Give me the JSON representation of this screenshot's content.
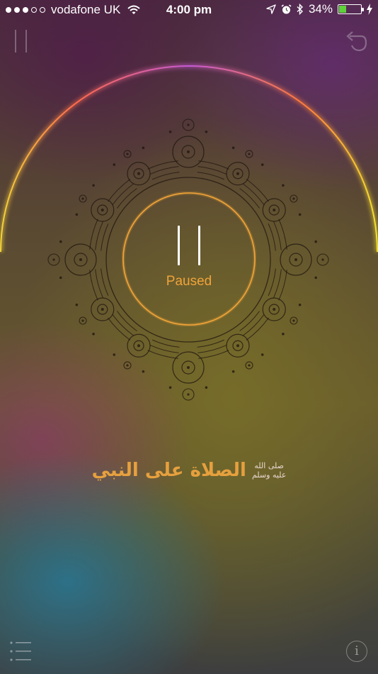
{
  "status_bar": {
    "carrier": "vodafone UK",
    "time": "4:00 pm",
    "battery_percent": "34%",
    "battery_level": 0.34,
    "signal_bars_filled": 3,
    "signal_bars_total": 5
  },
  "player": {
    "state_label": "Paused"
  },
  "title": {
    "arabic": "الصلاة على النبي",
    "honorific_line1": "صلى الله",
    "honorific_line2": "عليه وسلم"
  },
  "info_button": {
    "glyph": "i"
  },
  "colors": {
    "accent_orange": "#e6a03e",
    "battery_green": "#5fd13a"
  }
}
